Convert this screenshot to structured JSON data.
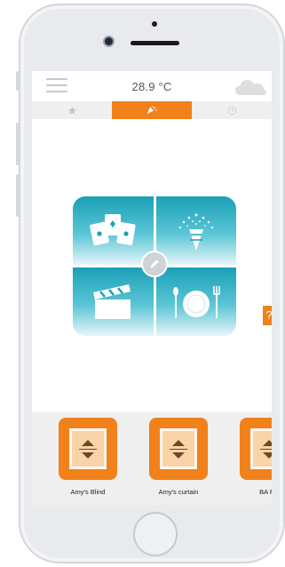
{
  "header": {
    "temperature": "28.9 °C",
    "weather_icon": "cloud-icon",
    "menu_icon": "hamburger-menu-icon"
  },
  "tabs": [
    {
      "icon": "star-icon",
      "active": false
    },
    {
      "icon": "scenes-icon",
      "active": true
    },
    {
      "icon": "clock-icon",
      "active": false
    }
  ],
  "scenes": [
    {
      "icon": "playing-cards-icon"
    },
    {
      "icon": "party-popper-icon"
    },
    {
      "icon": "clapperboard-icon"
    },
    {
      "icon": "dinner-plate-icon"
    }
  ],
  "help_label": "?",
  "devices": [
    {
      "label": "Amy's Blind"
    },
    {
      "label": "Amy's curtain"
    },
    {
      "label": "BA F..."
    }
  ],
  "colors": {
    "accent": "#f0811b",
    "tile_gradient_top": "#1aa0b6",
    "tile_gradient_bottom": "#e6f6f9"
  }
}
